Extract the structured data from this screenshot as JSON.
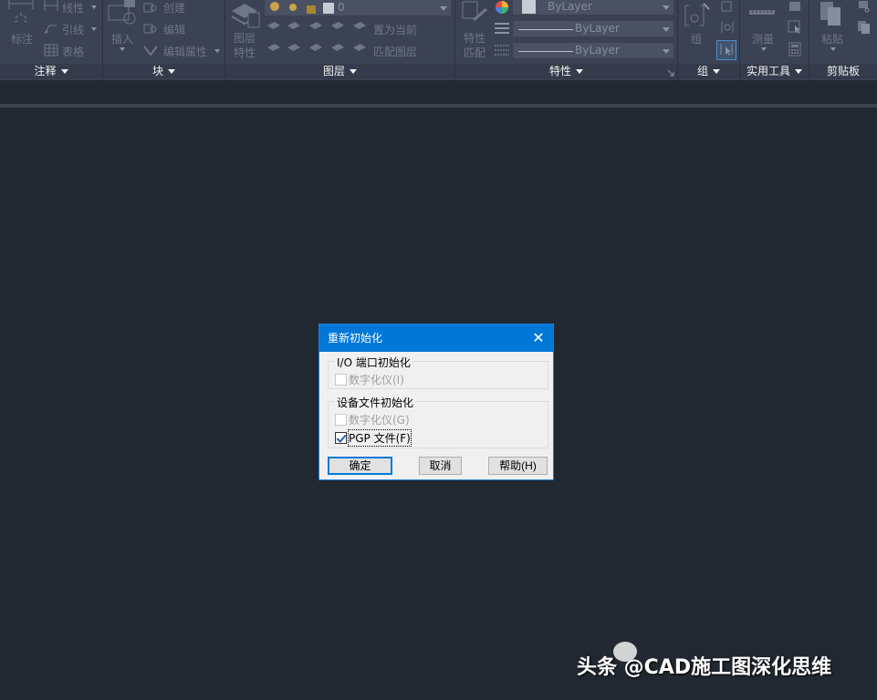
{
  "ribbon": {
    "panels": [
      {
        "title": "注释",
        "items": [
          "标注",
          "线性",
          "引线",
          "表格"
        ]
      },
      {
        "title": "块",
        "items": [
          "插入",
          "创建",
          "编辑",
          "编辑属性"
        ]
      },
      {
        "title": "图层",
        "items": [
          "图层特性",
          "置为当前",
          "匹配图层"
        ],
        "layer_value": "0"
      },
      {
        "title": "特性",
        "items": [
          "特性匹配"
        ],
        "color_value": "ByLayer",
        "linetype_value": "ByLayer",
        "lineweight_value": "ByLayer"
      },
      {
        "title": "组",
        "items": [
          "组"
        ]
      },
      {
        "title": "实用工具",
        "items": [
          "测量"
        ]
      },
      {
        "title": "剪贴板",
        "items": [
          "粘贴"
        ]
      }
    ]
  },
  "dialog": {
    "title": "重新初始化",
    "close_icon": "close-icon",
    "io_group": {
      "label": "I/O 端口初始化",
      "options": [
        {
          "label": "数字化仪(I)",
          "checked": false,
          "enabled": false
        }
      ]
    },
    "device_group": {
      "label": "设备文件初始化",
      "options": [
        {
          "label": "数字化仪(G)",
          "checked": false,
          "enabled": false
        },
        {
          "label": "PGP 文件(F)",
          "checked": true,
          "enabled": true
        }
      ]
    },
    "buttons": {
      "ok": "确定",
      "cancel": "取消",
      "help": "帮助(H)"
    }
  },
  "watermark": "头条 @CAD施工图深化思维"
}
